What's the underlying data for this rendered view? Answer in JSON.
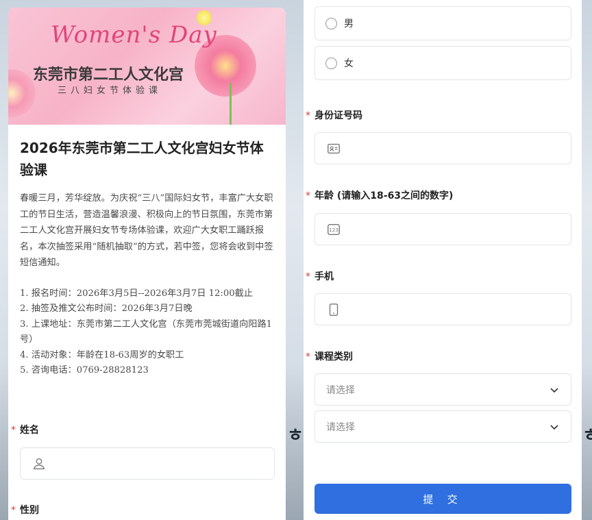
{
  "banner": {
    "script_title": "Women's Day",
    "main_title": "东莞市第二工人文化宫",
    "sub_title": "三八妇女节体验课"
  },
  "article": {
    "title": "2026年东莞市第二工人文化宫妇女节体验课",
    "intro": "春暖三月，芳华绽放。为庆祝“三八”国际妇女节，丰富广大女职工的节日生活，营造温馨浪漫、积极向上的节日氛围，东莞市第二工人文化宫开展妇女节专场体验课，欢迎广大女职工踊跃报名，本次抽签采用“随机抽取”的方式，若中签，您将会收到中签短信通知。",
    "details": [
      "1. 报名时间：2026年3月5日--2026年3月7日 12:00截止",
      "2. 抽签及推文公布时间：2026年3月7日晚",
      "3. 上课地址：东莞市第二工人文化宫（东莞市莞城街道向阳路1号）",
      "4. 活动对象：年龄在18-63周岁的女职工",
      "5. 咨询电话：0769-28828123"
    ]
  },
  "form": {
    "required_mark": "*",
    "name_label": "姓名",
    "gender_label": "性别",
    "gender_options": [
      "男",
      "女"
    ],
    "id_label": "身份证号码",
    "age_label": "年龄 (请输入18-63之间的数字)",
    "phone_label": "手机",
    "course_label": "课程类别",
    "select_placeholder": "请选择",
    "submit_label": "提 交"
  },
  "icons": {
    "name_field": "user-icon",
    "id_field": "id-card-icon",
    "age_field": "number-icon",
    "phone_field": "mobile-phone-icon",
    "select": "chevron-down-icon"
  },
  "colors": {
    "accent": "#2f6fe0",
    "required": "#e03a3a",
    "banner_pink": "#f7b3c7"
  }
}
